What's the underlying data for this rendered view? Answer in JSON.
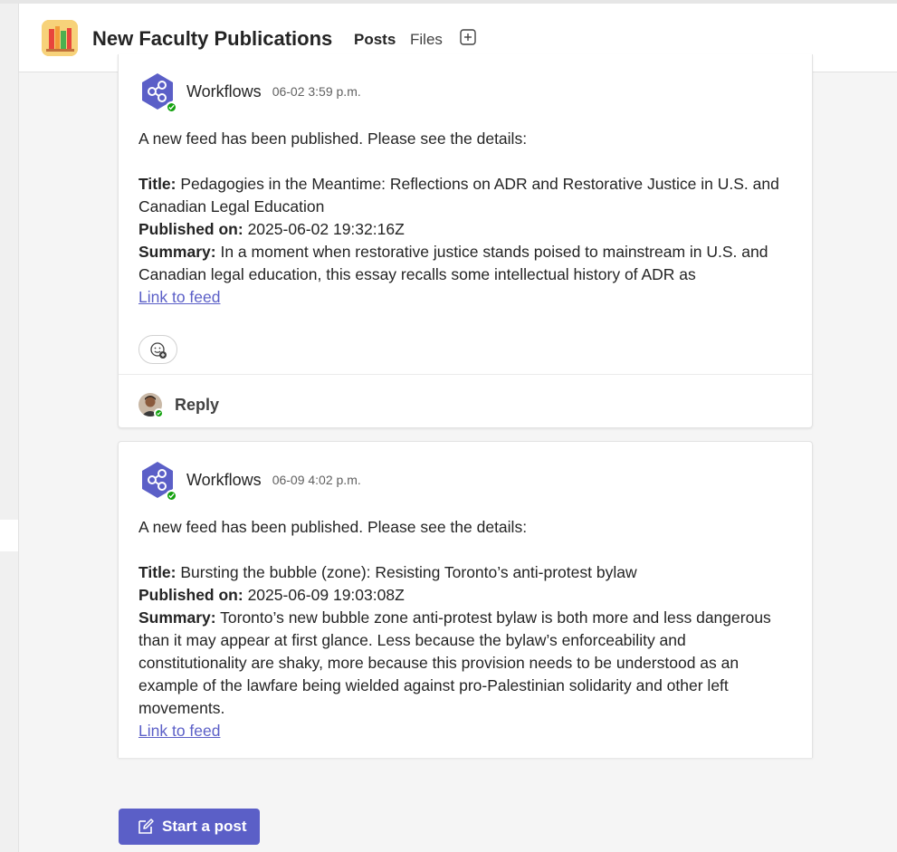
{
  "header": {
    "team_title": "New Faculty Publications",
    "team_avatar_icon": "books-icon",
    "tabs": [
      {
        "label": "Posts",
        "active": true
      },
      {
        "label": "Files",
        "active": false
      }
    ],
    "add_tab_icon": "add-tab-icon"
  },
  "colors": {
    "accent": "#5b5fc7",
    "presence_available": "#13a10e",
    "link": "#5b5fc7"
  },
  "posts": [
    {
      "author": "Workflows",
      "timestamp": "06-02 3:59 p.m.",
      "intro": "A new feed has been published. Please see the details:",
      "title_label": "Title:",
      "title": "Pedagogies in the Meantime: Reflections on ADR and Restorative Justice in U.S. and Canadian Legal Education",
      "published_label": "Published on:",
      "published": "2025-06-02 19:32:16Z",
      "summary_label": "Summary:",
      "summary": "In a moment when restorative justice stands poised to mainstream in U.S. and Canadian legal education, this essay recalls some intellectual history of ADR as",
      "link_text": "Link to feed",
      "reply_label": "Reply"
    },
    {
      "author": "Workflows",
      "timestamp": "06-09 4:02 p.m.",
      "intro": "A new feed has been published. Please see the details:",
      "title_label": "Title:",
      "title": "Bursting the bubble (zone): Resisting Toronto’s anti-protest bylaw",
      "published_label": "Published on:",
      "published": "2025-06-09 19:03:08Z",
      "summary_label": "Summary:",
      "summary": "Toronto’s new bubble zone anti-protest bylaw is both more and less dangerous than it may appear at first glance. Less because the bylaw’s enforceability and constitutionality are shaky, more because this provision needs to be understood as an example of the lawfare being wielded against pro-Palestinian solidarity and other left movements.",
      "link_text": "Link to feed"
    }
  ],
  "composer": {
    "start_post_label": "Start a post",
    "start_post_icon": "compose-icon"
  }
}
